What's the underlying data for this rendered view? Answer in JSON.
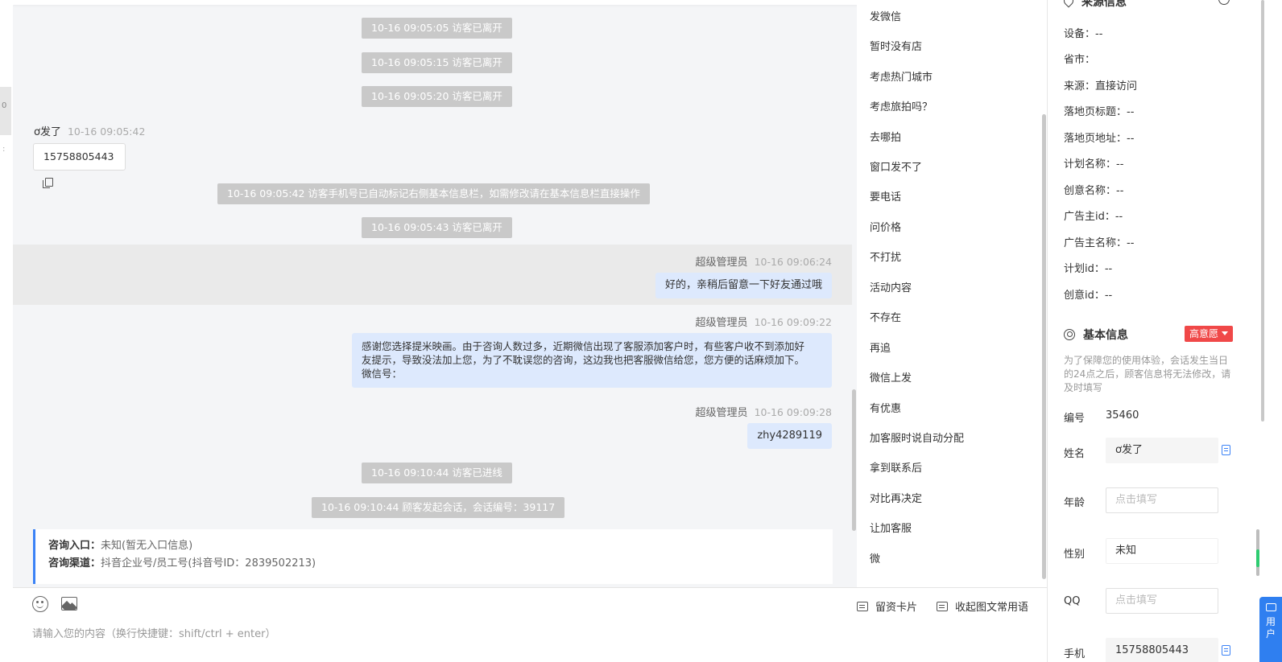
{
  "left_edge": {
    "mark": "0",
    "mark2": ":"
  },
  "chat": {
    "system_messages": [
      "10-16 09:05:05 访客已离开",
      "10-16 09:05:15 访客已离开",
      "10-16 09:05:20 访客已离开",
      "10-16 09:05:42 访客手机号已自动标记右侧基本信息栏，如需修改请在基本信息栏直接操作",
      "10-16 09:05:43 访客已离开",
      "10-16 09:10:44 访客已进线",
      "10-16 09:10:44 顾客发起会话，会话编号：39117"
    ],
    "visitor_message": {
      "name": "ơ发了",
      "time": "10-16 09:05:42",
      "phone": "15758805443"
    },
    "agent_messages": [
      {
        "name": "超级管理员",
        "time": "10-16 09:06:24",
        "lines": [
          "好的，亲稍后留意一下好友通过哦"
        ]
      },
      {
        "name": "超级管理员",
        "time": "10-16 09:09:22",
        "lines": [
          "感谢您选择提米映画。由于咨询人数过多，近期微信出现了客服添加客户时，有些客户收不到添加好",
          "友提示，导致没法加上您，为了不耽误您的咨询，这边我也把客服微信给您，您方便的话麻烦加下。",
          "微信号："
        ]
      },
      {
        "name": "超级管理员",
        "time": "10-16 09:09:28",
        "lines": [
          "zhy4289119"
        ]
      }
    ],
    "info_card": {
      "entry_label": "咨询入口：",
      "entry_value": "未知(暂无入口信息)",
      "channel_label": "咨询渠道：",
      "channel_value": "抖音企业号/员工号(抖音号ID：2839502213)"
    }
  },
  "input_area": {
    "lead_card_label": "留资卡片",
    "collapse_label": "收起图文常用语",
    "placeholder": "请输入您的内容（换行快捷键：shift/ctrl + enter）"
  },
  "quick_replies": [
    "发微信",
    "暂时没有店",
    "考虑热门城市",
    "考虑旅拍吗？",
    "去哪拍",
    "窗口发不了",
    "要电话",
    "问价格",
    "不打扰",
    "活动内容",
    "不存在",
    "再追",
    "微信上发",
    "有优惠",
    "加客服时说自动分配",
    "拿到联系后",
    "对比再决定",
    "让加客服",
    "微"
  ],
  "right_panel": {
    "source_title": "来源信息",
    "source_rows": [
      "设备：--",
      "省市：",
      "来源：直接访问",
      "落地页标题：--",
      "落地页地址：--",
      "计划名称：--",
      "创意名称：--",
      "广告主id：--",
      "广告主名称：--",
      "计划id：--",
      "创意id：--"
    ],
    "basic_title": "基本信息",
    "intent_badge": "高意愿",
    "note": "为了保障您的使用体验，会话发生当日的24点之后，顾客信息将无法修改，请及时填写",
    "fields": {
      "id_label": "编号",
      "id_value": "35460",
      "name_label": "姓名",
      "name_value": "ơ发了",
      "age_label": "年龄",
      "age_placeholder": "点击填写",
      "gender_label": "性别",
      "gender_value": "未知",
      "qq_label": "QQ",
      "qq_placeholder": "点击填写",
      "phone_label": "手机",
      "phone_value": "15758805443"
    }
  },
  "side_tab": {
    "label": "用户"
  }
}
